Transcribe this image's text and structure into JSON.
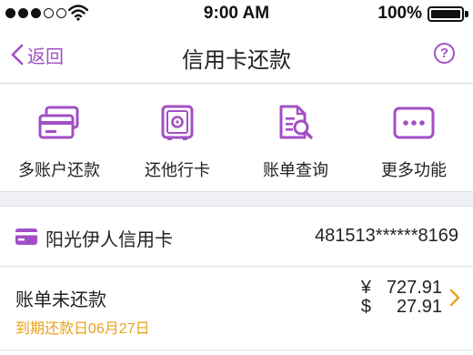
{
  "status_bar": {
    "time": "9:00 AM",
    "battery": "100%",
    "battery_level": 1.0,
    "signal_bars_filled": 3,
    "signal_bars_total": 5
  },
  "nav": {
    "back_label": "返回",
    "title": "信用卡还款",
    "help_label": "?"
  },
  "actions": [
    {
      "label": "多账户还款",
      "icon": "cards-icon"
    },
    {
      "label": "还他行卡",
      "icon": "safe-icon"
    },
    {
      "label": "账单查询",
      "icon": "bill-search-icon"
    },
    {
      "label": "更多功能",
      "icon": "more-icon"
    }
  ],
  "card": {
    "name": "阳光伊人信用卡",
    "number": "481513******8169",
    "icon": "credit-card-icon"
  },
  "bill": {
    "title": "账单未还款",
    "due": "到期还款日06月27日",
    "rmb_symbol": "¥",
    "rmb_amount": "727.91",
    "usd_symbol": "$",
    "usd_amount": "27.91"
  },
  "colors": {
    "accent": "#a24fc5",
    "due": "#e8a21b",
    "separator": "#efeff4"
  }
}
